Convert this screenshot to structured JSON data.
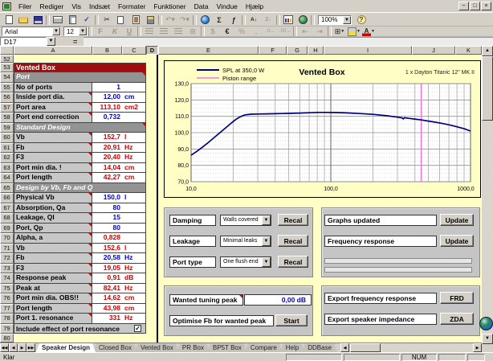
{
  "menu": {
    "items": [
      "Filer",
      "Rediger",
      "Vis",
      "Indsæt",
      "Formater",
      "Funktioner",
      "Data",
      "Vindue",
      "Hjælp"
    ],
    "window_controls": [
      "minimize",
      "restore",
      "close"
    ]
  },
  "toolbars": {
    "standard_icons": [
      "new-icon",
      "open-icon",
      "save-icon",
      "print-icon",
      "print-preview-icon",
      "spelling-icon",
      "cut-icon",
      "copy-icon",
      "paste-icon",
      "format-painter-icon",
      "undo-icon",
      "redo-icon",
      "web-toolbar-icon",
      "autosum-icon",
      "paste-function-icon",
      "sort-ascending-icon",
      "sort-descending-icon",
      "chart-wizard-icon",
      "map-icon",
      "help-icon"
    ],
    "formatting_icons": [
      "bold-icon",
      "italic-icon",
      "underline-icon",
      "align-left-icon",
      "align-center-icon",
      "align-right-icon",
      "merge-center-icon",
      "currency-icon",
      "euro-icon",
      "percent-icon",
      "comma-icon",
      "increase-decimal-icon",
      "decrease-decimal-icon",
      "decrease-indent-icon",
      "increase-indent-icon",
      "borders-icon",
      "fill-color-icon",
      "font-color-icon"
    ],
    "font_name": "Arial",
    "font_size": "12",
    "zoom_level": "100%"
  },
  "formula_bar": {
    "cell_ref": "D17",
    "formula": ""
  },
  "colors": {
    "input_value": "#0000cc",
    "output_value": "#cc0000",
    "table_title_bg": "#a00d0d",
    "sheet_bg": "#ffffc5",
    "spl_line": "#00007d",
    "piston_line": "#e87ae8"
  },
  "sheet": {
    "columns": [
      "A",
      "B",
      "C",
      "D",
      "E",
      "F",
      "G",
      "H",
      "I",
      "J",
      "K"
    ],
    "active_column": "D",
    "rows": [
      {
        "num": 52,
        "type": "blank"
      },
      {
        "num": 53,
        "type": "title",
        "label": "Vented Box"
      },
      {
        "num": 54,
        "type": "section",
        "label": "Port",
        "mark": true
      },
      {
        "num": 55,
        "type": "data",
        "label": "No of ports",
        "value": "1",
        "unit": "",
        "color": "input",
        "mark": false
      },
      {
        "num": 56,
        "type": "data",
        "label": "Inside port dia.",
        "value": "12,00",
        "unit": "cm",
        "color": "input",
        "mark": true
      },
      {
        "num": 57,
        "type": "data",
        "label": "Port area",
        "value": "113,10",
        "unit": "cm2",
        "color": "output",
        "mark": true
      },
      {
        "num": 58,
        "type": "data",
        "label": "Port end correction",
        "value": "0,732",
        "unit": "",
        "color": "input",
        "mark": true
      },
      {
        "num": 59,
        "type": "section",
        "label": "Standard Design",
        "mark": true
      },
      {
        "num": 60,
        "type": "data",
        "label": "Vb",
        "value": "152,7",
        "unit": "l",
        "color": "output",
        "mark": true
      },
      {
        "num": 61,
        "type": "data",
        "label": "Fb",
        "value": "20,91",
        "unit": "Hz",
        "color": "output",
        "mark": true
      },
      {
        "num": 62,
        "type": "data",
        "label": "F3",
        "value": "20,40",
        "unit": "Hz",
        "color": "output",
        "mark": true
      },
      {
        "num": 63,
        "type": "data",
        "label": "Port min dia. !",
        "value": "14,04",
        "unit": "cm",
        "color": "output",
        "mark": true
      },
      {
        "num": 64,
        "type": "data",
        "label": "Port length",
        "value": "42,27",
        "unit": "cm",
        "color": "output",
        "mark": true
      },
      {
        "num": 65,
        "type": "section",
        "label": "Design by Vb, Fb and Q",
        "mark": false
      },
      {
        "num": 66,
        "type": "data",
        "label": "Physical Vb",
        "value": "150,0",
        "unit": "l",
        "color": "input",
        "mark": true
      },
      {
        "num": 67,
        "type": "data",
        "label": "Absorption, Qa",
        "value": "80",
        "unit": "",
        "color": "input",
        "mark": true
      },
      {
        "num": 68,
        "type": "data",
        "label": "Leakage, Ql",
        "value": "15",
        "unit": "",
        "color": "input",
        "mark": true
      },
      {
        "num": 69,
        "type": "data",
        "label": "Port, Qp",
        "value": "80",
        "unit": "",
        "color": "input",
        "mark": true
      },
      {
        "num": 70,
        "type": "data",
        "label": "Alpha, a",
        "value": "0,828",
        "unit": "",
        "color": "output",
        "mark": true
      },
      {
        "num": 71,
        "type": "data",
        "label": "Vb",
        "value": "152,6",
        "unit": "l",
        "color": "output",
        "mark": true
      },
      {
        "num": 72,
        "type": "data",
        "label": "Fb",
        "value": "20,58",
        "unit": "Hz",
        "color": "input",
        "mark": true
      },
      {
        "num": 73,
        "type": "data",
        "label": "F3",
        "value": "19,05",
        "unit": "Hz",
        "color": "output",
        "mark": true
      },
      {
        "num": 74,
        "type": "data",
        "label": "Response peak",
        "value": "0,91",
        "unit": "dB",
        "color": "output",
        "mark": true
      },
      {
        "num": 75,
        "type": "data",
        "label": "Peak at",
        "value": "82,41",
        "unit": "Hz",
        "color": "output",
        "mark": true
      },
      {
        "num": 76,
        "type": "data",
        "label": "Port min dia. OBS!!",
        "value": "14,62",
        "unit": "cm",
        "color": "output",
        "mark": true
      },
      {
        "num": 77,
        "type": "data",
        "label": "Port length",
        "value": "43,98",
        "unit": "cm",
        "color": "output",
        "mark": true
      },
      {
        "num": 78,
        "type": "data",
        "label": "Port 1. resonance",
        "value": "331",
        "unit": "Hz",
        "color": "output",
        "mark": true
      },
      {
        "num": 79,
        "type": "check",
        "label": "Include effect of port resonance",
        "checked": true
      },
      {
        "num": 80,
        "type": "blank"
      }
    ]
  },
  "chart": {
    "title": "Vented Box",
    "annotation": "1 x Dayton Titanic 12\" MK II",
    "legend": [
      {
        "label": "SPL at 350,0 W",
        "color": "#00007d"
      },
      {
        "label": "Piston range",
        "color": "#e87ae8"
      }
    ],
    "chart_data": {
      "type": "line",
      "x_scale": "log",
      "xlim": [
        10,
        1000
      ],
      "ylim": [
        70,
        130
      ],
      "x_ticks": [
        "10,0",
        "100,0",
        "1000,0"
      ],
      "y_ticks": [
        "130,0",
        "120,0",
        "110,0",
        "100,0",
        "90,0",
        "80,0",
        "70,0"
      ],
      "grid": true,
      "series": [
        {
          "name": "SPL at 350,0 W",
          "color": "#00007d",
          "points": [
            [
              10,
              86.2
            ],
            [
              11,
              88.6
            ],
            [
              12,
              91.0
            ],
            [
              13,
              93.3
            ],
            [
              14,
              95.6
            ],
            [
              15,
              97.8
            ],
            [
              16,
              99.8
            ],
            [
              17,
              101.7
            ],
            [
              18,
              103.5
            ],
            [
              19,
              105.2
            ],
            [
              20,
              106.8
            ],
            [
              21,
              108.2
            ],
            [
              22,
              109.3
            ],
            [
              23,
              110.1
            ],
            [
              24,
              110.7
            ],
            [
              25,
              111.0
            ],
            [
              27,
              111.3
            ],
            [
              30,
              111.4
            ],
            [
              35,
              111.5
            ],
            [
              40,
              111.6
            ],
            [
              45,
              111.7
            ],
            [
              50,
              111.8
            ],
            [
              60,
              112.0
            ],
            [
              70,
              112.2
            ],
            [
              82,
              112.4
            ],
            [
              95,
              112.4
            ],
            [
              110,
              112.3
            ],
            [
              130,
              112.1
            ],
            [
              160,
              111.7
            ],
            [
              200,
              111.2
            ],
            [
              250,
              110.4
            ],
            [
              300,
              109.5
            ],
            [
              322,
              109.1
            ],
            [
              331,
              108.4
            ],
            [
              336,
              109.2
            ],
            [
              350,
              108.9
            ],
            [
              400,
              108.3
            ],
            [
              450,
              107.7
            ],
            [
              500,
              107.1
            ],
            [
              560,
              106.4
            ],
            [
              630,
              105.6
            ],
            [
              710,
              104.7
            ],
            [
              800,
              103.6
            ],
            [
              900,
              102.4
            ],
            [
              1000,
              101.0
            ]
          ]
        },
        {
          "name": "Piston range",
          "color": "#e87ae8",
          "vertical_line_x": 444
        }
      ]
    }
  },
  "panels": {
    "recal": {
      "rows": [
        {
          "label": "Damping",
          "value": "Walls covered",
          "button": "Recal"
        },
        {
          "label": "Leakage",
          "value": "Minimal leaks",
          "button": "Recal"
        },
        {
          "label": "Port type",
          "value": "One flush end",
          "button": "Recal"
        }
      ]
    },
    "update": {
      "rows": [
        {
          "label": "Graphs updated",
          "button": "Update"
        },
        {
          "label": "Frequency response",
          "button": "Update"
        }
      ]
    },
    "tuning": {
      "peak_label": "Wanted tuning peak",
      "peak_value": "0,00 dB",
      "optimise_label": "Optimise Fb for wanted peak",
      "optimise_button": "Start"
    },
    "export": {
      "rows": [
        {
          "label": "Export frequency response",
          "button": "FRD"
        },
        {
          "label": "Export speaker impedance",
          "button": "ZDA"
        }
      ]
    }
  },
  "tabs": {
    "items": [
      "Speaker Design",
      "Closed Box",
      "Vented Box",
      "PR Box",
      "BP5T Box",
      "Compare",
      "Help",
      "DDBase"
    ],
    "active": "Speaker Design"
  },
  "status": {
    "mode": "Klar",
    "num_lock": "NUM"
  }
}
